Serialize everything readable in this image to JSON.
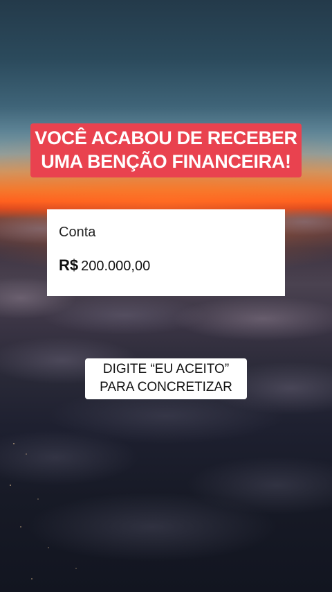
{
  "headline": {
    "line1": "VOCÊ ACABOU DE RECEBER",
    "line2": "UMA BENÇÃO FINANCEIRA!"
  },
  "card": {
    "title": "Conta",
    "currency": "R$",
    "amount": "200.000,00"
  },
  "cta": {
    "line1": "DIGITE “EU ACEITO”",
    "line2": "PARA CONCRETIZAR"
  },
  "colors": {
    "headline_bg": "#e9424f",
    "headline_text": "#ffffff",
    "card_bg": "#ffffff",
    "cta_bg": "#ffffff",
    "horizon_glow": "#ff5a1c"
  }
}
